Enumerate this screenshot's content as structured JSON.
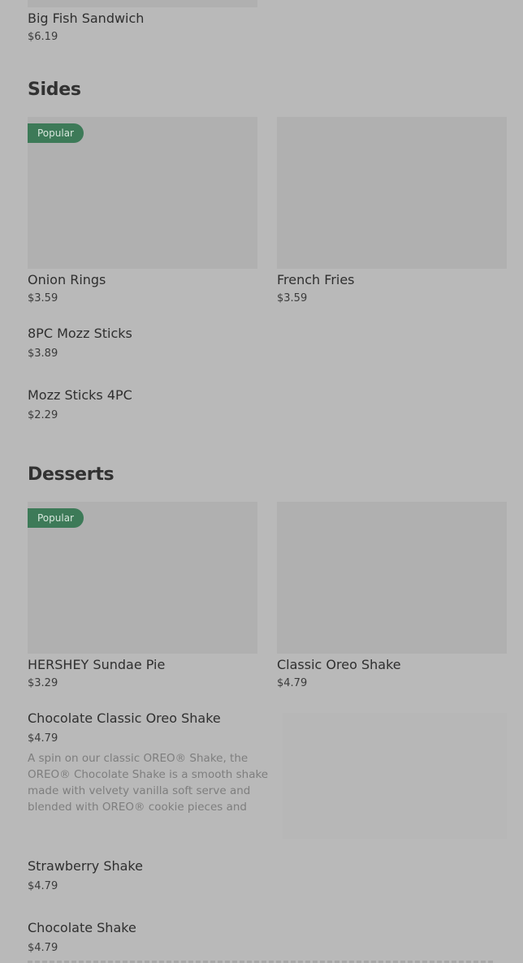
{
  "top_item": {
    "name": "Big Fish Sandwich",
    "price": "$6.19"
  },
  "sections": {
    "sides": {
      "title": "Sides",
      "items": [
        {
          "name": "Onion Rings",
          "price": "$3.59",
          "badge": "Popular"
        },
        {
          "name": "French Fries",
          "price": "$3.59"
        },
        {
          "name": "8PC Mozz Sticks",
          "price": "$3.89"
        },
        {
          "name": "Mozz Sticks 4PC",
          "price": "$2.29"
        }
      ]
    },
    "desserts": {
      "title": "Desserts",
      "items": [
        {
          "name": "HERSHEY Sundae Pie",
          "price": "$3.29",
          "badge": "Popular"
        },
        {
          "name": "Classic Oreo Shake",
          "price": "$4.79"
        },
        {
          "name": "Chocolate Classic Oreo Shake",
          "price": "$4.79",
          "description": "A spin on our classic OREO® Shake, the OREO® Chocolate Shake is a smooth shake made with velvety vanilla soft serve and blended with OREO® cookie pieces and chocolate sauce...."
        },
        {
          "name": "Strawberry Shake",
          "price": "$4.79"
        },
        {
          "name": "Chocolate Shake",
          "price": "$4.79"
        }
      ]
    }
  },
  "colors": {
    "overlay_background": "#b9b9b9",
    "image_placeholder": "#b0b0b0",
    "badge_background": "#3d7a58",
    "text_primary": "#2f2f2f",
    "text_secondary": "#7e7e7e"
  }
}
